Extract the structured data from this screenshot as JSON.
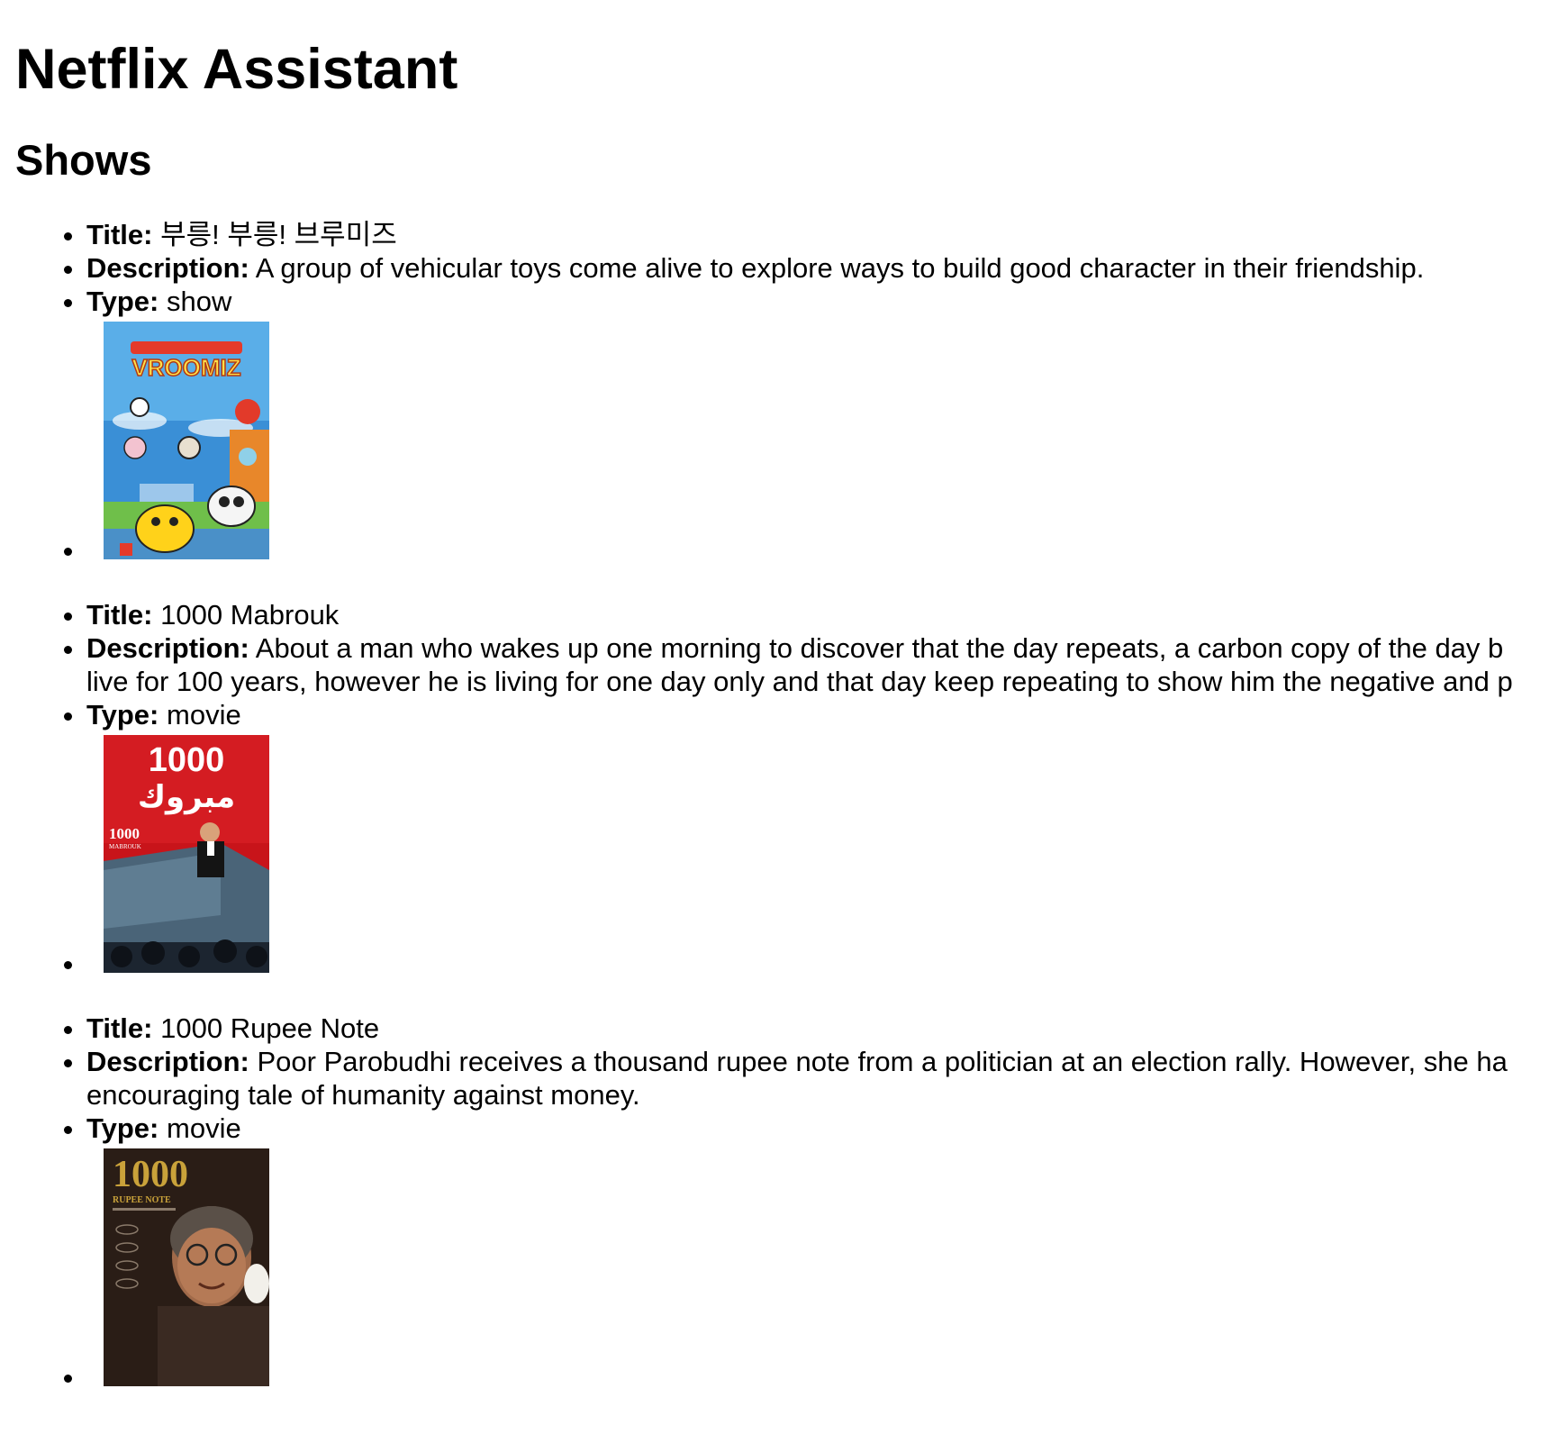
{
  "app": {
    "title": "Netflix Assistant",
    "section_heading": "Shows"
  },
  "labels": {
    "title": "Title:",
    "description": "Description:",
    "type": "Type:"
  },
  "shows": [
    {
      "title": "부릉! 부릉! 브루미즈",
      "description": "A group of vehicular toys come alive to explore ways to build good character in their friendship.",
      "description_line2": "",
      "type": "show",
      "poster": {
        "text_top": "VROOMIZ",
        "colors": {
          "sky": "#3a8fd6",
          "ground": "#6fbf4a",
          "accent": "#e8c21a"
        }
      }
    },
    {
      "title": "1000 Mabrouk",
      "description": "About a man who wakes up one morning to discover that the day repeats, a carbon copy of the day b",
      "description_line2": "live for 100 years, however he is living for one day only and that day keep repeating to show him the negative and p",
      "type": "movie",
      "poster": {
        "text_top": "1000",
        "text_arabic": "مبروك",
        "text_small": "1000",
        "text_small2": "MABROUK",
        "colors": {
          "bg": "#c8141a",
          "dark": "#1c2530"
        }
      }
    },
    {
      "title": "1000 Rupee Note",
      "description": "Poor Parobudhi receives a thousand rupee note from a politician at an election rally. However, she ha",
      "description_line2": "encouraging tale of humanity against money.",
      "type": "movie",
      "poster": {
        "text_top": "1000",
        "text_sub": "RUPEE NOTE",
        "colors": {
          "bg": "#2a1d16",
          "gold": "#c9a23a"
        }
      }
    }
  ]
}
